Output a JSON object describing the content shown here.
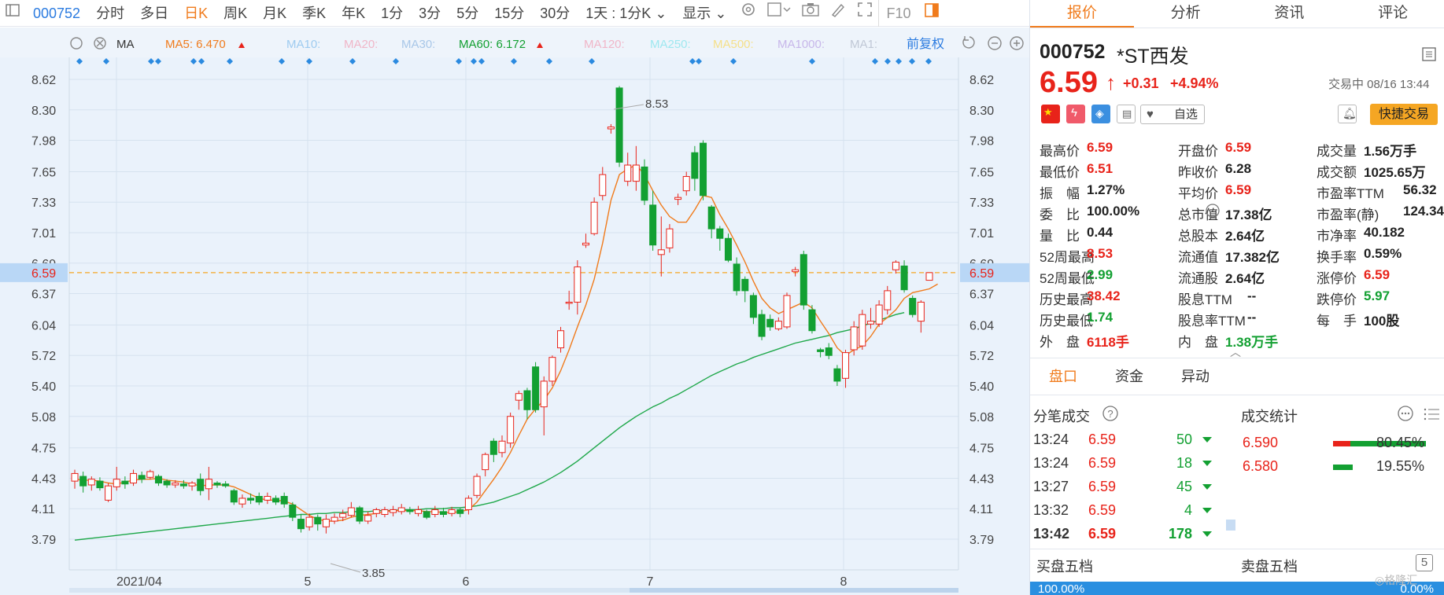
{
  "toolbar": {
    "code": "000752",
    "items": [
      "分时",
      "多日",
      "日K",
      "周K",
      "月K",
      "季K",
      "年K",
      "1分",
      "3分",
      "5分",
      "15分",
      "30分"
    ],
    "active": "日K",
    "mode": "1天 : 1分K",
    "display": "显示",
    "f10": "F10"
  },
  "ma_bar": {
    "ma": "MA",
    "ma5": "MA5: 6.470",
    "ma10": "MA10:",
    "ma20": "MA20:",
    "ma30": "MA30:",
    "ma60": "MA60: 6.172",
    "ma120": "MA120:",
    "ma250": "MA250:",
    "ma500": "MA500:",
    "ma1000": "MA1000:",
    "ma1": "MA1:",
    "fuquan": "前复权"
  },
  "colors": {
    "up": "#e8231a",
    "down": "#13a032",
    "ma5": "#f07b1c",
    "ma60": "#1fa84a",
    "accent": "#f07b1c",
    "link": "#2b7be0"
  },
  "chart_data": {
    "type": "candlestick",
    "y_ticks": [
      "8.62",
      "8.30",
      "7.98",
      "7.65",
      "7.33",
      "7.01",
      "6.69",
      "6.37",
      "6.04",
      "5.72",
      "5.40",
      "5.08",
      "4.75",
      "4.43",
      "4.11",
      "3.79"
    ],
    "ylim": [
      3.79,
      8.62
    ],
    "x_labels": [
      "2021/04",
      "5",
      "6",
      "7",
      "8"
    ],
    "current_price": "6.59",
    "high_label": "8.53",
    "low_label": "3.85",
    "candles": [
      {
        "o": 4.4,
        "c": 4.48,
        "h": 4.52,
        "l": 4.32
      },
      {
        "o": 4.45,
        "c": 4.35,
        "h": 4.5,
        "l": 4.28
      },
      {
        "o": 4.36,
        "c": 4.42,
        "h": 4.45,
        "l": 4.3
      },
      {
        "o": 4.4,
        "c": 4.33,
        "h": 4.44,
        "l": 4.3
      },
      {
        "o": 4.2,
        "c": 4.35,
        "h": 4.38,
        "l": 4.18
      },
      {
        "o": 4.34,
        "c": 4.42,
        "h": 4.55,
        "l": 4.3
      },
      {
        "o": 4.4,
        "c": 4.37,
        "h": 4.45,
        "l": 4.32
      },
      {
        "o": 4.38,
        "c": 4.48,
        "h": 4.52,
        "l": 4.35
      },
      {
        "o": 4.46,
        "c": 4.42,
        "h": 4.5,
        "l": 4.38
      },
      {
        "o": 4.44,
        "c": 4.5,
        "h": 4.52,
        "l": 4.42
      },
      {
        "o": 4.45,
        "c": 4.38,
        "h": 4.47,
        "l": 4.35
      },
      {
        "o": 4.4,
        "c": 4.36,
        "h": 4.42,
        "l": 4.33
      },
      {
        "o": 4.36,
        "c": 4.38,
        "h": 4.41,
        "l": 4.33
      },
      {
        "o": 4.37,
        "c": 4.35,
        "h": 4.41,
        "l": 4.32
      },
      {
        "o": 4.35,
        "c": 4.38,
        "h": 4.4,
        "l": 4.3
      },
      {
        "o": 4.42,
        "c": 4.3,
        "h": 4.48,
        "l": 4.25
      },
      {
        "o": 4.32,
        "c": 4.42,
        "h": 4.55,
        "l": 4.2
      },
      {
        "o": 4.38,
        "c": 4.36,
        "h": 4.4,
        "l": 4.33
      },
      {
        "o": 4.37,
        "c": 4.35,
        "h": 4.4,
        "l": 4.33
      },
      {
        "o": 4.3,
        "c": 4.18,
        "h": 4.32,
        "l": 4.15
      },
      {
        "o": 4.16,
        "c": 4.22,
        "h": 4.26,
        "l": 4.12
      },
      {
        "o": 4.22,
        "c": 4.2,
        "h": 4.27,
        "l": 4.16
      },
      {
        "o": 4.24,
        "c": 4.18,
        "h": 4.28,
        "l": 4.15
      },
      {
        "o": 4.2,
        "c": 4.24,
        "h": 4.28,
        "l": 4.16
      },
      {
        "o": 4.22,
        "c": 4.18,
        "h": 4.25,
        "l": 4.15
      },
      {
        "o": 4.24,
        "c": 4.16,
        "h": 4.28,
        "l": 4.12
      },
      {
        "o": 4.15,
        "c": 4.02,
        "h": 4.18,
        "l": 3.98
      },
      {
        "o": 4.0,
        "c": 3.9,
        "h": 4.05,
        "l": 3.86
      },
      {
        "o": 3.92,
        "c": 4.02,
        "h": 4.06,
        "l": 3.88
      },
      {
        "o": 4.02,
        "c": 3.95,
        "h": 4.05,
        "l": 3.88
      },
      {
        "o": 3.92,
        "c": 4.0,
        "h": 4.05,
        "l": 3.85
      },
      {
        "o": 3.98,
        "c": 4.02,
        "h": 4.06,
        "l": 3.95
      },
      {
        "o": 4.02,
        "c": 4.06,
        "h": 4.1,
        "l": 3.98
      },
      {
        "o": 4.04,
        "c": 4.12,
        "h": 4.18,
        "l": 4.02
      },
      {
        "o": 4.12,
        "c": 3.98,
        "h": 4.14,
        "l": 3.95
      },
      {
        "o": 3.98,
        "c": 4.04,
        "h": 4.08,
        "l": 3.95
      },
      {
        "o": 4.06,
        "c": 4.1,
        "h": 4.12,
        "l": 4.02
      },
      {
        "o": 4.05,
        "c": 4.1,
        "h": 4.13,
        "l": 4.02
      },
      {
        "o": 4.07,
        "c": 4.1,
        "h": 4.14,
        "l": 4.03
      },
      {
        "o": 4.08,
        "c": 4.12,
        "h": 4.16,
        "l": 4.05
      },
      {
        "o": 4.1,
        "c": 4.08,
        "h": 4.13,
        "l": 4.05
      },
      {
        "o": 4.06,
        "c": 4.1,
        "h": 4.14,
        "l": 4.03
      },
      {
        "o": 4.08,
        "c": 4.02,
        "h": 4.1,
        "l": 4.0
      },
      {
        "o": 4.05,
        "c": 4.1,
        "h": 4.14,
        "l": 4.02
      },
      {
        "o": 4.08,
        "c": 4.05,
        "h": 4.12,
        "l": 4.02
      },
      {
        "o": 4.06,
        "c": 4.1,
        "h": 4.13,
        "l": 4.03
      },
      {
        "o": 4.1,
        "c": 4.06,
        "h": 4.12,
        "l": 4.02
      },
      {
        "o": 4.1,
        "c": 4.22,
        "h": 4.25,
        "l": 4.05
      },
      {
        "o": 4.25,
        "c": 4.45,
        "h": 4.48,
        "l": 4.22
      },
      {
        "o": 4.52,
        "c": 4.68,
        "h": 4.7,
        "l": 4.45
      },
      {
        "o": 4.82,
        "c": 4.68,
        "h": 4.85,
        "l": 4.6
      },
      {
        "o": 4.7,
        "c": 4.82,
        "h": 4.88,
        "l": 4.65
      },
      {
        "o": 4.8,
        "c": 5.08,
        "h": 5.12,
        "l": 4.75
      },
      {
        "o": 5.25,
        "c": 5.32,
        "h": 5.35,
        "l": 5.15
      },
      {
        "o": 5.35,
        "c": 5.15,
        "h": 5.38,
        "l": 5.05
      },
      {
        "o": 5.6,
        "c": 5.15,
        "h": 5.65,
        "l": 5.12
      },
      {
        "o": 5.18,
        "c": 5.45,
        "h": 5.5,
        "l": 4.88
      },
      {
        "o": 5.45,
        "c": 5.7,
        "h": 5.72,
        "l": 5.4
      },
      {
        "o": 5.8,
        "c": 5.98,
        "h": 6.02,
        "l": 5.75
      },
      {
        "o": 6.27,
        "c": 6.28,
        "h": 6.4,
        "l": 6.2
      },
      {
        "o": 6.28,
        "c": 6.65,
        "h": 6.72,
        "l": 6.15
      },
      {
        "o": 6.88,
        "c": 6.9,
        "h": 7.0,
        "l": 6.85
      },
      {
        "o": 7.0,
        "c": 7.33,
        "h": 7.38,
        "l": 6.98
      },
      {
        "o": 7.4,
        "c": 7.62,
        "h": 7.7,
        "l": 7.35
      },
      {
        "o": 8.1,
        "c": 8.12,
        "h": 8.15,
        "l": 8.05
      },
      {
        "o": 8.53,
        "c": 7.75,
        "h": 8.55,
        "l": 7.7
      },
      {
        "o": 7.55,
        "c": 7.72,
        "h": 7.85,
        "l": 7.5
      },
      {
        "o": 7.55,
        "c": 7.72,
        "h": 7.92,
        "l": 7.45
      },
      {
        "o": 7.7,
        "c": 7.35,
        "h": 7.78,
        "l": 7.3
      },
      {
        "o": 7.3,
        "c": 6.88,
        "h": 7.45,
        "l": 6.82
      },
      {
        "o": 6.78,
        "c": 6.83,
        "h": 7.18,
        "l": 6.55
      },
      {
        "o": 6.85,
        "c": 7.05,
        "h": 7.1,
        "l": 6.8
      },
      {
        "o": 7.36,
        "c": 7.38,
        "h": 7.42,
        "l": 7.3
      },
      {
        "o": 7.45,
        "c": 7.6,
        "h": 7.65,
        "l": 7.4
      },
      {
        "o": 7.85,
        "c": 7.58,
        "h": 7.92,
        "l": 7.45
      },
      {
        "o": 7.95,
        "c": 7.4,
        "h": 7.98,
        "l": 7.35
      },
      {
        "o": 7.28,
        "c": 7.05,
        "h": 7.3,
        "l": 6.95
      },
      {
        "o": 7.05,
        "c": 6.95,
        "h": 7.08,
        "l": 6.82
      },
      {
        "o": 6.95,
        "c": 6.72,
        "h": 7.0,
        "l": 6.7
      },
      {
        "o": 6.68,
        "c": 6.4,
        "h": 6.75,
        "l": 6.35
      },
      {
        "o": 6.52,
        "c": 6.4,
        "h": 6.55,
        "l": 6.28
      },
      {
        "o": 6.35,
        "c": 6.12,
        "h": 6.38,
        "l": 6.05
      },
      {
        "o": 6.15,
        "c": 5.92,
        "h": 6.2,
        "l": 5.88
      },
      {
        "o": 6.1,
        "c": 6.02,
        "h": 6.15,
        "l": 5.98
      },
      {
        "o": 6.0,
        "c": 6.08,
        "h": 6.12,
        "l": 5.98
      },
      {
        "o": 6.02,
        "c": 6.35,
        "h": 6.38,
        "l": 6.0
      },
      {
        "o": 6.6,
        "c": 6.62,
        "h": 6.65,
        "l": 6.55
      },
      {
        "o": 6.78,
        "c": 6.25,
        "h": 6.82,
        "l": 6.2
      },
      {
        "o": 6.2,
        "c": 5.98,
        "h": 6.25,
        "l": 5.95
      },
      {
        "o": 5.78,
        "c": 5.76,
        "h": 5.8,
        "l": 5.7
      },
      {
        "o": 5.8,
        "c": 5.72,
        "h": 5.85,
        "l": 5.68
      },
      {
        "o": 5.58,
        "c": 5.45,
        "h": 5.62,
        "l": 5.4
      },
      {
        "o": 5.48,
        "c": 5.75,
        "h": 5.78,
        "l": 5.38
      },
      {
        "o": 5.78,
        "c": 6.02,
        "h": 6.08,
        "l": 5.72
      },
      {
        "o": 5.82,
        "c": 6.15,
        "h": 6.2,
        "l": 5.78
      },
      {
        "o": 6.05,
        "c": 6.08,
        "h": 6.22,
        "l": 6.0
      },
      {
        "o": 6.05,
        "c": 6.25,
        "h": 6.3,
        "l": 6.02
      },
      {
        "o": 6.2,
        "c": 6.4,
        "h": 6.45,
        "l": 6.15
      },
      {
        "o": 6.62,
        "c": 6.7,
        "h": 6.72,
        "l": 6.58
      },
      {
        "o": 6.66,
        "c": 6.41,
        "h": 6.72,
        "l": 6.38
      },
      {
        "o": 6.32,
        "c": 6.15,
        "h": 6.35,
        "l": 6.12
      },
      {
        "o": 6.08,
        "c": 6.28,
        "h": 6.3,
        "l": 5.96
      },
      {
        "o": 6.51,
        "c": 6.59,
        "h": 6.59,
        "l": 6.51
      }
    ],
    "ma5": [
      4.42,
      4.41,
      4.41,
      4.4,
      4.38,
      4.37,
      4.39,
      4.41,
      4.42,
      4.42,
      4.43,
      4.41,
      4.4,
      4.39,
      4.37,
      4.35,
      4.36,
      4.36,
      4.36,
      4.34,
      4.3,
      4.26,
      4.22,
      4.2,
      4.2,
      4.19,
      4.16,
      4.1,
      4.04,
      4.0,
      3.98,
      3.98,
      3.99,
      4.02,
      4.04,
      4.05,
      4.06,
      4.08,
      4.09,
      4.09,
      4.09,
      4.09,
      4.08,
      4.08,
      4.07,
      4.07,
      4.08,
      4.1,
      4.18,
      4.3,
      4.42,
      4.55,
      4.7,
      4.88,
      5.05,
      5.16,
      5.25,
      5.38,
      5.56,
      5.78,
      6.02,
      6.25,
      6.52,
      6.9,
      7.35,
      7.62,
      7.68,
      7.72,
      7.62,
      7.45,
      7.3,
      7.18,
      7.12,
      7.12,
      7.25,
      7.4,
      7.38,
      7.2,
      7.05,
      6.88,
      6.7,
      6.5,
      6.32,
      6.22,
      6.16,
      6.2,
      6.24,
      6.28,
      6.22,
      6.08,
      5.95,
      5.8,
      5.72,
      5.78,
      5.82,
      5.92,
      6.05,
      6.12,
      6.2,
      6.32,
      6.38,
      6.4,
      6.42,
      6.47
    ],
    "ma60": [
      3.78,
      3.79,
      3.8,
      3.81,
      3.82,
      3.83,
      3.84,
      3.85,
      3.86,
      3.87,
      3.88,
      3.89,
      3.9,
      3.91,
      3.92,
      3.93,
      3.94,
      3.95,
      3.96,
      3.97,
      3.98,
      3.99,
      4.0,
      4.01,
      4.02,
      4.03,
      4.04,
      4.05,
      4.05,
      4.06,
      4.06,
      4.07,
      4.07,
      4.08,
      4.08,
      4.08,
      4.09,
      4.09,
      4.09,
      4.1,
      4.1,
      4.1,
      4.11,
      4.11,
      4.11,
      4.12,
      4.12,
      4.13,
      4.14,
      4.16,
      4.18,
      4.21,
      4.24,
      4.27,
      4.31,
      4.35,
      4.39,
      4.44,
      4.49,
      4.55,
      4.61,
      4.68,
      4.75,
      4.82,
      4.89,
      4.96,
      5.02,
      5.08,
      5.13,
      5.18,
      5.22,
      5.27,
      5.31,
      5.36,
      5.41,
      5.46,
      5.51,
      5.55,
      5.59,
      5.63,
      5.66,
      5.7,
      5.73,
      5.76,
      5.79,
      5.82,
      5.85,
      5.87,
      5.89,
      5.91,
      5.93,
      5.96,
      5.98,
      6.0,
      6.03,
      6.06,
      6.09,
      6.12,
      6.15,
      6.17
    ]
  },
  "panel": {
    "tabs": [
      "报价",
      "分析",
      "资讯",
      "评论"
    ],
    "active_tab": "报价",
    "code": "000752",
    "name": "*ST西发",
    "price": "6.59",
    "arrow": "↑",
    "change": "+0.31",
    "pct": "+4.94%",
    "status": "交易中 08/16 13:44",
    "watch": "自选",
    "trade": "快捷交易",
    "stats": [
      {
        "l": "最高价",
        "v": "6.59",
        "c": "red"
      },
      {
        "l": "开盘价",
        "v": "6.59",
        "c": "red"
      },
      {
        "l": "成交量",
        "v": "1.56万手",
        "c": "blk"
      },
      {
        "l": "最低价",
        "v": "6.51",
        "c": "red"
      },
      {
        "l": "昨收价",
        "v": "6.28",
        "c": "blk"
      },
      {
        "l": "成交额",
        "v": "1025.65万",
        "c": "blk"
      },
      {
        "l": "振　幅",
        "v": "1.27%",
        "c": "blk"
      },
      {
        "l": "平均价",
        "v": "6.59",
        "c": "red"
      },
      {
        "l": "市盈率TTM",
        "v": "56.32",
        "c": "blk"
      },
      {
        "l": "委　比",
        "v": "100.00%",
        "c": "blk"
      },
      {
        "l": "总市值",
        "v": "17.38亿",
        "c": "blk"
      },
      {
        "l": "市盈率(静)",
        "v": "124.34",
        "c": "blk"
      },
      {
        "l": "量　比",
        "v": "0.44",
        "c": "blk"
      },
      {
        "l": "总股本",
        "v": "2.64亿",
        "c": "blk"
      },
      {
        "l": "市净率",
        "v": "40.182",
        "c": "blk"
      },
      {
        "l": "52周最高",
        "v": "8.53",
        "c": "red"
      },
      {
        "l": "流通值",
        "v": "17.382亿",
        "c": "blk"
      },
      {
        "l": "换手率",
        "v": "0.59%",
        "c": "blk"
      },
      {
        "l": "52周最低",
        "v": "2.99",
        "c": "green"
      },
      {
        "l": "流通股",
        "v": "2.64亿",
        "c": "blk"
      },
      {
        "l": "涨停价",
        "v": "6.59",
        "c": "red"
      },
      {
        "l": "历史最高",
        "v": "38.42",
        "c": "red"
      },
      {
        "l": "股息TTM",
        "v": "--",
        "c": "blk"
      },
      {
        "l": "跌停价",
        "v": "5.97",
        "c": "green"
      },
      {
        "l": "历史最低",
        "v": "1.74",
        "c": "green"
      },
      {
        "l": "股息率TTM",
        "v": "--",
        "c": "blk"
      },
      {
        "l": "每　手",
        "v": "100股",
        "c": "blk"
      },
      {
        "l": "外　盘",
        "v": "6118手",
        "c": "red"
      },
      {
        "l": "内　盘",
        "v": "1.38万手",
        "c": "green"
      }
    ],
    "subtabs": [
      "盘口",
      "资金",
      "异动"
    ],
    "ticks_title": "分笔成交",
    "stat_title": "成交统计",
    "ticks": [
      {
        "t": "13:24",
        "p": "6.59",
        "v": "50"
      },
      {
        "t": "13:24",
        "p": "6.59",
        "v": "18"
      },
      {
        "t": "13:27",
        "p": "6.59",
        "v": "45"
      },
      {
        "t": "13:32",
        "p": "6.59",
        "v": "4"
      },
      {
        "t": "13:42",
        "p": "6.59",
        "v": "178"
      }
    ],
    "stat_rows": [
      {
        "p": "6.590",
        "pct": "80.45%",
        "frac": 0.8045
      },
      {
        "p": "6.580",
        "pct": "19.55%",
        "frac": 0.1955
      }
    ],
    "buy5": "买盘五档",
    "sell5": "卖盘五档",
    "bottom_left": "100.00%",
    "bottom_right": "0.00%"
  }
}
